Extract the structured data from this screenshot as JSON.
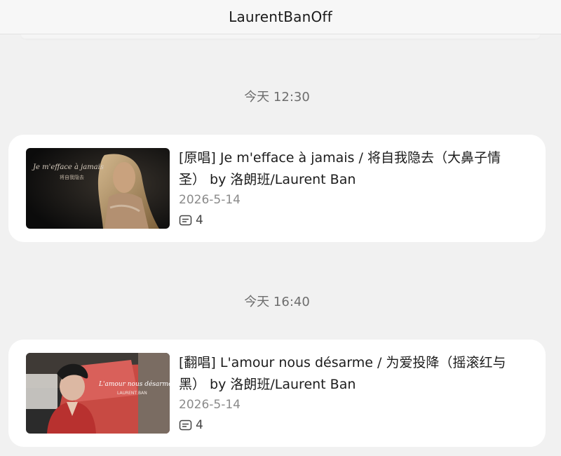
{
  "header": {
    "title": "LaurentBanOff"
  },
  "feed": [
    {
      "time": "今天 12:30",
      "title": "[原唱] Je m'effac​e à jamais / 将自我隐去（大鼻子情圣） by 洛朗班/Laurent Ban",
      "date": "2026-5-14",
      "comments": "4",
      "thumb_text_1": "Je m'efface à jamais",
      "thumb_text_2": "将自我隐去",
      "icon": "comment-icon"
    },
    {
      "time": "今天 16:40",
      "title": "[翻唱] L'amour nous désarme / 为爱投降（摇滚红与黑） by 洛朗班/Laurent Ban",
      "date": "2026-5-14",
      "comments": "4",
      "thumb_text_1": "L'amour nous désarme",
      "thumb_text_2": "LAURENT BAN",
      "icon": "comment-icon"
    }
  ]
}
